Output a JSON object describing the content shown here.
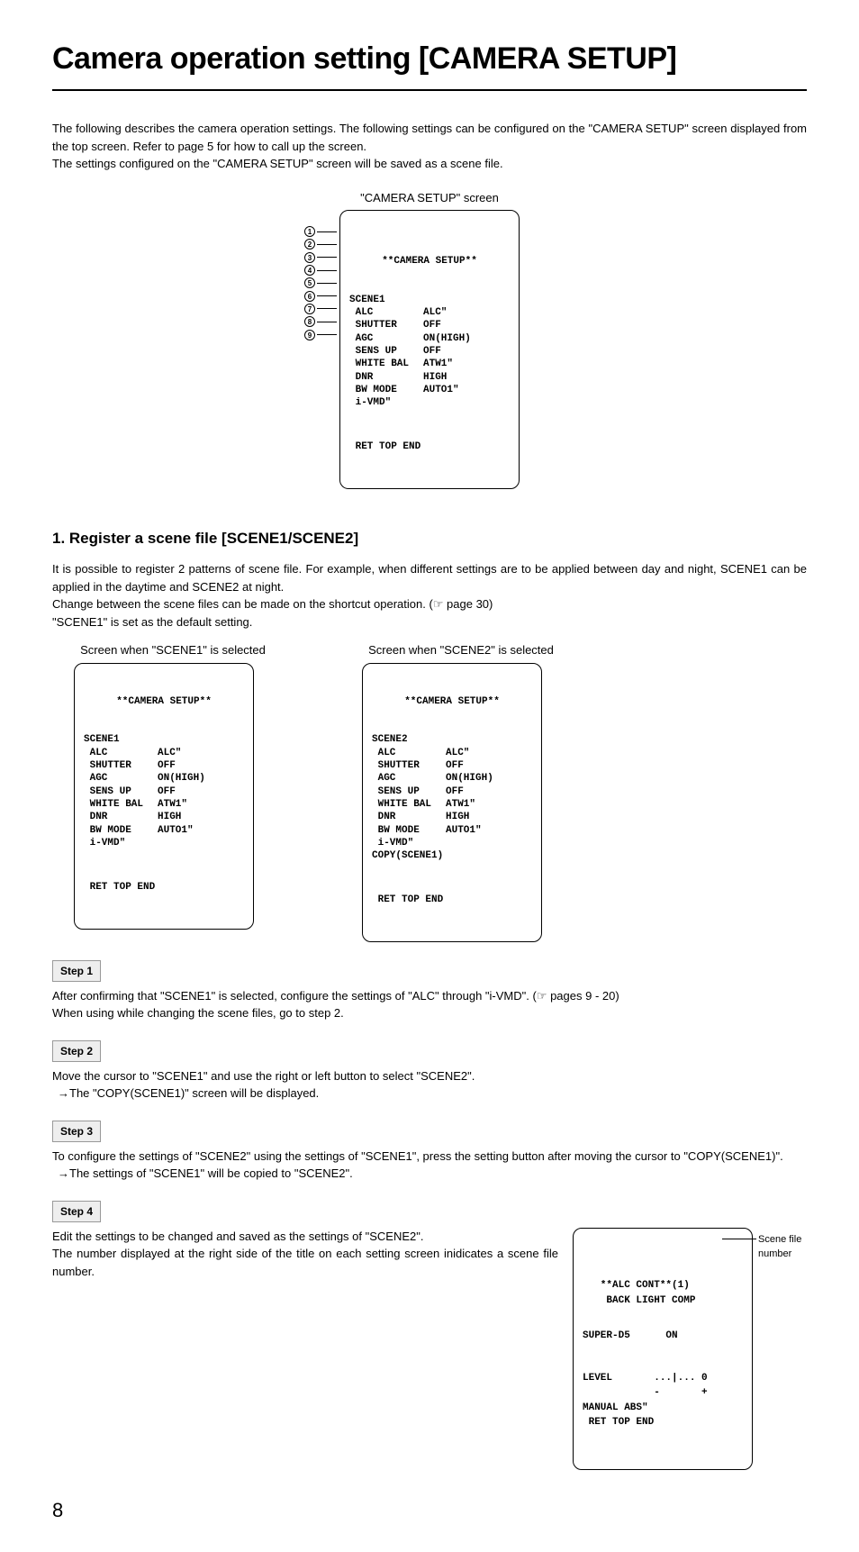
{
  "title": "Camera operation setting [CAMERA SETUP]",
  "intro1": "The following describes the camera operation settings. The following settings can be configured on the \"CAMERA SETUP\" screen displayed from the top screen. Refer to page 5 for how to call up the screen.",
  "intro2": "The settings configured on the \"CAMERA SETUP\" screen will be saved as a scene file.",
  "osd_title_label": "\"CAMERA SETUP\" screen",
  "osd_header": "**CAMERA SETUP**",
  "main_osd": {
    "rows": [
      {
        "c1": "SCENE1",
        "c2": ""
      },
      {
        "c1": " ALC",
        "c2": "ALC\""
      },
      {
        "c1": " SHUTTER",
        "c2": "OFF"
      },
      {
        "c1": " AGC",
        "c2": "ON(HIGH)"
      },
      {
        "c1": " SENS UP",
        "c2": "OFF"
      },
      {
        "c1": " WHITE BAL",
        "c2": "ATW1\""
      },
      {
        "c1": " DNR",
        "c2": "HIGH"
      },
      {
        "c1": " BW MODE",
        "c2": "AUTO1\""
      },
      {
        "c1": " i-VMD\"",
        "c2": ""
      }
    ],
    "footer": " RET TOP END"
  },
  "callouts": [
    "1",
    "2",
    "3",
    "4",
    "5",
    "6",
    "7",
    "8",
    "9"
  ],
  "section1_title": "1. Register a scene file [SCENE1/SCENE2]",
  "section1_p1": "It is possible to register 2 patterns of scene file. For example, when different settings are to be applied between day and night, SCENE1 can be applied in the daytime and SCENE2 at night.",
  "section1_p2": "Change between the scene files can be made on the shortcut operation. (☞ page 30)",
  "section1_p3": "\"SCENE1\" is set as the default setting.",
  "scene1_label": "Screen when \"SCENE1\" is selected",
  "scene2_label": "Screen when \"SCENE2\" is selected",
  "scene1_rows": [
    {
      "c1": "SCENE1",
      "c2": ""
    },
    {
      "c1": " ALC",
      "c2": "ALC\""
    },
    {
      "c1": " SHUTTER",
      "c2": "OFF"
    },
    {
      "c1": " AGC",
      "c2": "ON(HIGH)"
    },
    {
      "c1": " SENS UP",
      "c2": "OFF"
    },
    {
      "c1": " WHITE BAL",
      "c2": "ATW1\""
    },
    {
      "c1": " DNR",
      "c2": "HIGH"
    },
    {
      "c1": " BW MODE",
      "c2": "AUTO1\""
    },
    {
      "c1": " i-VMD\"",
      "c2": ""
    }
  ],
  "scene1_footer": " RET TOP END",
  "scene2_rows": [
    {
      "c1": "SCENE2",
      "c2": ""
    },
    {
      "c1": " ALC",
      "c2": "ALC\""
    },
    {
      "c1": " SHUTTER",
      "c2": "OFF"
    },
    {
      "c1": " AGC",
      "c2": "ON(HIGH)"
    },
    {
      "c1": " SENS UP",
      "c2": "OFF"
    },
    {
      "c1": " WHITE BAL",
      "c2": "ATW1\""
    },
    {
      "c1": " DNR",
      "c2": "HIGH"
    },
    {
      "c1": " BW MODE",
      "c2": "AUTO1\""
    },
    {
      "c1": " i-VMD\"",
      "c2": ""
    },
    {
      "c1": "COPY(SCENE1)",
      "c2": ""
    }
  ],
  "scene2_footer": " RET TOP END",
  "steps": {
    "s1_label": "Step 1",
    "s1_p1": "After confirming that \"SCENE1\" is selected, configure the settings of \"ALC\" through \"i-VMD\". (☞ pages 9 - 20)",
    "s1_p2": "When using while changing the scene files, go to step 2.",
    "s2_label": "Step 2",
    "s2_p1": "Move the cursor to \"SCENE1\" and use the right or left button to select \"SCENE2\".",
    "s2_p2": "The \"COPY(SCENE1)\" screen will be displayed.",
    "s3_label": "Step 3",
    "s3_p1": "To configure the settings of \"SCENE2\" using the settings of \"SCENE1\", press the setting button after moving the cursor to \"COPY(SCENE1)\".",
    "s3_p2": "The settings of \"SCENE1\" will be copied to \"SCENE2\".",
    "s4_label": "Step 4",
    "s4_p1": "Edit the settings to be changed and saved as the settings of \"SCENE2\".",
    "s4_p2": "The number displayed at the right side of the title on each setting screen inidicates a scene file number."
  },
  "alc_box": {
    "l1": "   **ALC CONT**(1)",
    "l2": "    BACK LIGHT COMP",
    "l3": "SUPER-D5      ON",
    "l4": "",
    "l5": "LEVEL       ...|... 0",
    "l6": "            -       +",
    "l7": "MANUAL ABS\"",
    "l8": " RET TOP END",
    "annot": "Scene file number"
  },
  "page_number": "8"
}
